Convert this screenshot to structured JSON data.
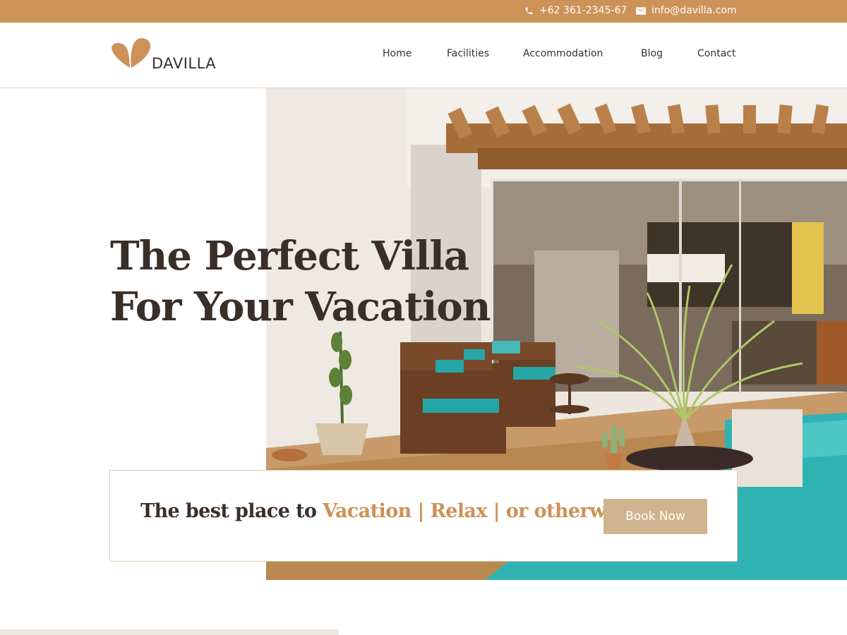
{
  "topbar": {
    "phone": "+62 361-2345-67",
    "email": "info@davilla.com",
    "background": "#cc9257"
  },
  "logo": {
    "text": "DAVILLA",
    "color": "#cc9257"
  },
  "nav": {
    "items": [
      "Home",
      "Facilities",
      "Accommodation",
      "Blog",
      "Contact"
    ]
  },
  "hero": {
    "title_line1": "The Perfect Villa",
    "title_line2": "For Your Vacation",
    "image": "villa-patio-pool-photo"
  },
  "cta": {
    "prefix": "The best place to ",
    "highlight": "Vacation | Relax | or otherwise",
    "button_label": "Book Now",
    "accent": "#cc9257",
    "button_color": "#cfb48f"
  }
}
